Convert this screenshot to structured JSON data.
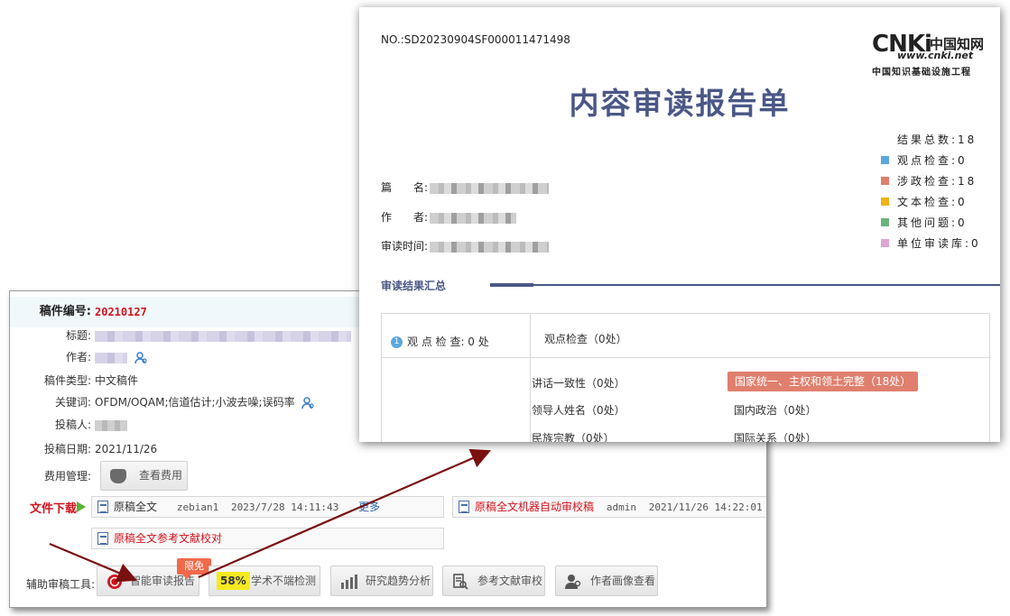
{
  "report": {
    "report_no": "NO.:SD20230904SF000011471498",
    "logo": {
      "main": "CNKi",
      "cn": "中国知网",
      "url": "www.cnki.net",
      "sub": "中国知识基础设施工程"
    },
    "title": "内容审读报告单",
    "meta": {
      "title_label": "篇　　名:",
      "author_label": "作　　者:",
      "time_label": "审读时间:"
    },
    "stats": [
      {
        "label": "结果总数:",
        "value": "18",
        "color": ""
      },
      {
        "label": "观点检查:",
        "value": "0",
        "color": "#5ba8e0"
      },
      {
        "label": "涉政检查:",
        "value": "18",
        "color": "#e07f6e"
      },
      {
        "label": "文本检查:",
        "value": "0",
        "color": "#f0b21a"
      },
      {
        "label": "其他问题:",
        "value": "0",
        "color": "#6cb37a"
      },
      {
        "label": "单位审读库:",
        "value": "0",
        "color": "#dba6d4"
      }
    ],
    "section_title": "审读结果汇总",
    "table": {
      "row1_badge": "1",
      "row1_left": "观 点 检 查: 0 处",
      "row1_right": "观点检查（0处）",
      "items": [
        "讲话一致性（0处）",
        "领导人姓名（0处）",
        "民族宗教（0处）"
      ],
      "highlight": "国家统一、主权和领土完整（18处）",
      "items_right": [
        "国内政治（0处）",
        "国际关系（0处）"
      ]
    }
  },
  "system": {
    "ms_no_label": "稿件编号:",
    "ms_no": "20210127",
    "title_label": "标题:",
    "author_label": "作者:",
    "type_label": "稿件类型:",
    "type_value": "中文稿件",
    "keywords_label": "关键词:",
    "keywords_value": "OFDM/OQAM;信道估计;小波去噪;误码率",
    "submitter_label": "投稿人:",
    "date_label": "投稿日期:",
    "date_value": "2021/11/26",
    "fee_label": "费用管理:",
    "fee_button": "查看费用",
    "download_label": "文件下载",
    "files": [
      {
        "name": "原稿全文",
        "user": "zebian1",
        "time": "2023/7/28 14:11:43",
        "more": "更多"
      },
      {
        "name": "原稿全文机器自动审校稿",
        "user": "admin",
        "time": "2021/11/26 14:22:01"
      },
      {
        "name": "原稿全文参考文献校对"
      }
    ],
    "tools_label": "辅助审稿工具:",
    "tools": {
      "badge": "限免",
      "smart_review": "智能审读报告",
      "percent": "58%",
      "plagiarism": "学术不端检测",
      "trend": "研究趋势分析",
      "ref_check": "参考文献审校",
      "portrait": "作者画像查看"
    }
  },
  "colors": {
    "title": "#4a5787",
    "accent_red": "#d4121c",
    "arrow": "#7a1010"
  }
}
